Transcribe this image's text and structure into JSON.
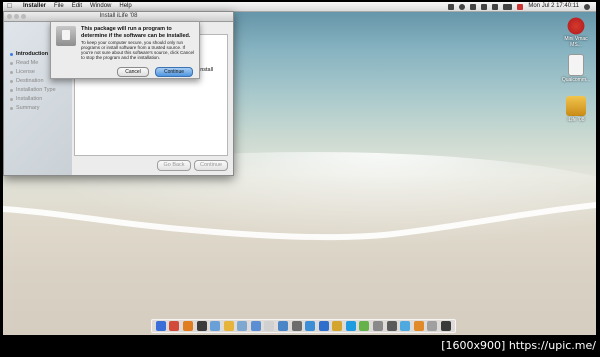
{
  "menubar": {
    "app": "Installer",
    "menus": [
      "File",
      "Edit",
      "Window",
      "Help"
    ],
    "clock": "Mon Jul 2  17:40:11"
  },
  "desktop_icons": [
    {
      "label": "Mini Vmac MS..."
    },
    {
      "label": "Qualcomm..."
    },
    {
      "label": "iLife '08"
    }
  ],
  "installer": {
    "title": "Install iLife '08",
    "steps": [
      "Introduction",
      "Read Me",
      "License",
      "Destination",
      "Installation Type",
      "Installation",
      "Summary"
    ],
    "active_step": 0,
    "pane_text": "install",
    "go_back": "Go Back",
    "continue": "Continue"
  },
  "alert": {
    "title": "This package will run a program to determine if the software can be installed.",
    "body": "To keep your computer secure, you should only run programs or install software from a trusted source. If you're not sure about this software's source, click Cancel to stop the program and the installation.",
    "cancel": "Cancel",
    "continue": "Continue"
  },
  "dock": {
    "icon_colors": [
      "#3a6fd8",
      "#d24a3a",
      "#e07d21",
      "#3b3b3b",
      "#6aa0d8",
      "#e6b43a",
      "#7fa8d0",
      "#5c8ed4",
      "#d0d0d0",
      "#4a86c7",
      "#6c6c6c",
      "#3c8fd6",
      "#2f6fcc",
      "#d3a52e",
      "#1f9be0",
      "#66b24a",
      "#8a8a8a",
      "#5a5a5a",
      "#4ea9df",
      "#e08a2a",
      "#a0a0a0",
      "#3a3a3a"
    ]
  },
  "footer": {
    "credit": "[1600x900] https://upic.me/"
  }
}
